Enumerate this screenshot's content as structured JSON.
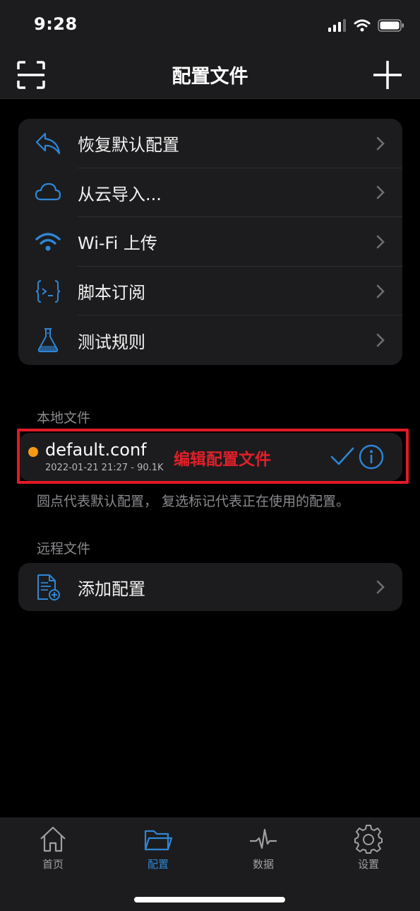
{
  "status_bar": {
    "time": "9:28"
  },
  "nav": {
    "title": "配置文件",
    "left_icon": "scan-icon",
    "right_icon": "plus-icon"
  },
  "menu": {
    "items": [
      {
        "label": "恢复默认配置",
        "icon": "undo-arrow-icon"
      },
      {
        "label": "从云导入...",
        "icon": "cloud-icon"
      },
      {
        "label": "Wi-Fi 上传",
        "icon": "wifi-icon"
      },
      {
        "label": "脚本订阅",
        "icon": "code-braces-icon"
      },
      {
        "label": "测试规则",
        "icon": "flask-icon"
      }
    ]
  },
  "local": {
    "header": "本地文件",
    "file": {
      "name": "default.conf",
      "meta": "2022-01-21 21:27 - 90.1K",
      "default_dot_color": "#f79a12"
    },
    "annotation": "编辑配置文件",
    "note": "圆点代表默认配置， 复选标记代表正在使用的配置。"
  },
  "remote": {
    "header": "远程文件",
    "add_label": "添加配置",
    "add_icon": "document-add-icon"
  },
  "tabs": [
    {
      "label": "首页",
      "icon": "house-icon",
      "active": false
    },
    {
      "label": "配置",
      "icon": "folder-icon",
      "active": true
    },
    {
      "label": "数据",
      "icon": "pulse-icon",
      "active": false
    },
    {
      "label": "设置",
      "icon": "gear-icon",
      "active": false
    }
  ],
  "colors": {
    "accent": "#2f86d6",
    "highlight": "#e11a26",
    "background": "#000000",
    "card": "#1c1c1e"
  }
}
